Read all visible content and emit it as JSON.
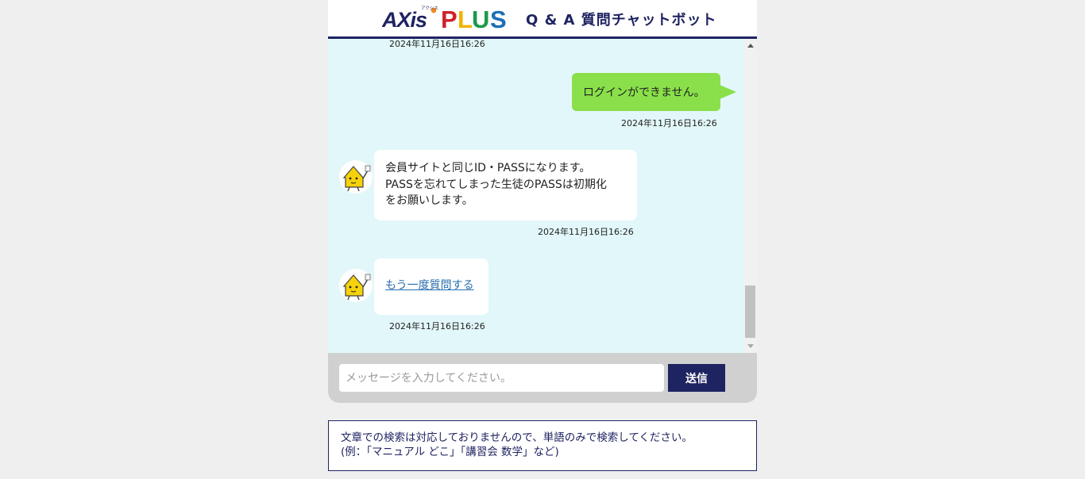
{
  "header": {
    "logo_text": "AXIS PLUS",
    "logo_ruby": "アクシス",
    "title": "Q & A 質問チャットボット"
  },
  "chat": {
    "messages": [
      {
        "role": "bot",
        "timestamp": "2024年11月16日16:26"
      },
      {
        "role": "user",
        "text": "ログインができません。",
        "timestamp": "2024年11月16日16:26"
      },
      {
        "role": "bot",
        "lines": [
          "会員サイトと同じID・PASSになります。",
          "PASSを忘れてしまった生徒のPASSは初期化",
          "をお願いします。"
        ],
        "timestamp": "2024年11月16日16:26"
      },
      {
        "role": "bot",
        "link_text": "もう一度質問する",
        "timestamp": "2024年11月16日16:26"
      }
    ],
    "avatar_icon": "house-mascot-icon"
  },
  "input": {
    "placeholder": "メッセージを入力してください。",
    "value": "",
    "send_label": "送信"
  },
  "notice": {
    "line1": "文章での検索は対応しておりませんので、単語のみで検索してください。",
    "line2": "(例：「マニュアル どこ」「講習会 数学」など)"
  },
  "colors": {
    "navy": "#1e2361",
    "chat_bg": "#e2f7f9",
    "user_bubble": "#8ae04a",
    "page_bg": "#efefef",
    "logo_p": "#d0202a",
    "logo_l": "#f0b400",
    "logo_u": "#1a9a4a",
    "logo_s": "#1a6fb5"
  }
}
